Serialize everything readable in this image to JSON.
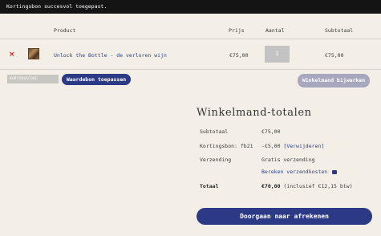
{
  "notice": {
    "text": "Kortingsbon succesvol toegepast."
  },
  "cart_table": {
    "headers": {
      "product": "Product",
      "price": "Prijs",
      "quantity": "Aantal",
      "subtotal": "Subtotaal"
    },
    "items": [
      {
        "remove_symbol": "×",
        "name": "Unlock the Bottle - de verloren wijn",
        "price": "€75,00",
        "quantity": "1",
        "subtotal": "€75,00"
      }
    ]
  },
  "coupon": {
    "placeholder": "KORTINGSCODE",
    "apply_label": "Waardebon toepassen"
  },
  "update_cart_label": "Winkelmand bijwerken",
  "totals": {
    "title": "Winkelmand-totalen",
    "subtotal_label": "Subtotaal",
    "subtotal_value": "€75,00",
    "discount_label": "Kortingsbon: fb21",
    "discount_value": "-€5,00",
    "discount_remove": "[Verwijderen]",
    "shipping_label": "Verzending",
    "shipping_value": "Gratis verzending",
    "shipping_calc": "Bereken verzendkosten",
    "total_label": "Totaal",
    "total_value": "€70,00",
    "total_note": "(inclusief €12,15 btw)"
  },
  "checkout_label": "Doorgaan naar afrekenen",
  "colors": {
    "accent": "#2c3a86",
    "remove": "#d01818",
    "background": "#f3efe6"
  },
  "icons": {
    "remove": "close-icon",
    "shipping": "truck-icon"
  }
}
